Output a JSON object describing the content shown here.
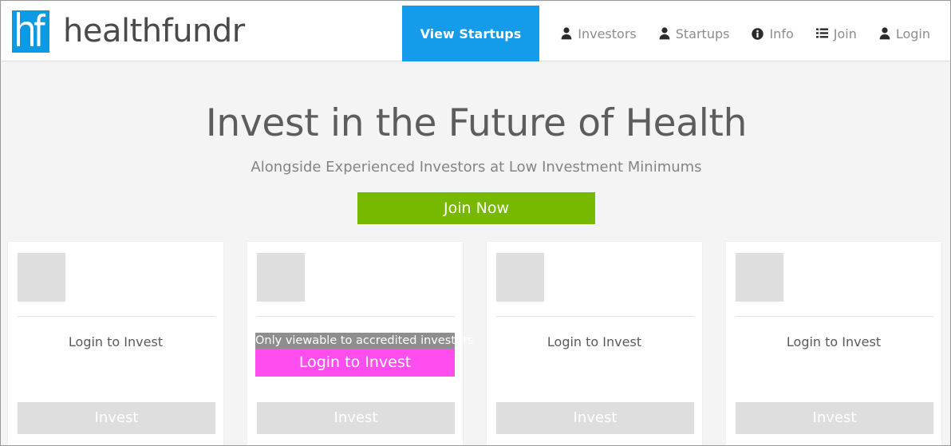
{
  "brand": {
    "logo_text": "hf",
    "logo_icon": "hf-monogram-icon",
    "name": "healthfundr",
    "logo_color": "#0d9ae5"
  },
  "nav": {
    "items": [
      {
        "label": "View Startups",
        "icon": null,
        "active": true
      },
      {
        "label": "Investors",
        "icon": "user-icon",
        "active": false
      },
      {
        "label": "Startups",
        "icon": "user-icon",
        "active": false
      },
      {
        "label": "Info",
        "icon": "info-circle-icon",
        "active": false
      },
      {
        "label": "Join",
        "icon": "list-icon",
        "active": false
      },
      {
        "label": "Login",
        "icon": "user-icon",
        "active": false
      }
    ],
    "active_color": "#149bea"
  },
  "hero": {
    "title": "Invest in the Future of Health",
    "subtitle": "Alongside Experienced Investors at Low Investment Minimums",
    "cta_label": "Join Now",
    "cta_color": "#76b900"
  },
  "cards": [
    {
      "thumb": "startup-logo-placeholder",
      "login_label": "Login to Invest",
      "invest_label": "Invest",
      "hovered": false,
      "tooltip": null
    },
    {
      "thumb": "startup-logo-placeholder",
      "login_label": "Login to Invest",
      "invest_label": "Invest",
      "hovered": true,
      "tooltip": "Only viewable to accredited investors",
      "hover_color": "#ff4df0",
      "tooltip_color": "#8e8e8e"
    },
    {
      "thumb": "startup-logo-placeholder",
      "login_label": "Login to Invest",
      "invest_label": "Invest",
      "hovered": false,
      "tooltip": null
    },
    {
      "thumb": "startup-logo-placeholder",
      "login_label": "Login to Invest",
      "invest_label": "Invest",
      "hovered": false,
      "tooltip": null
    }
  ]
}
